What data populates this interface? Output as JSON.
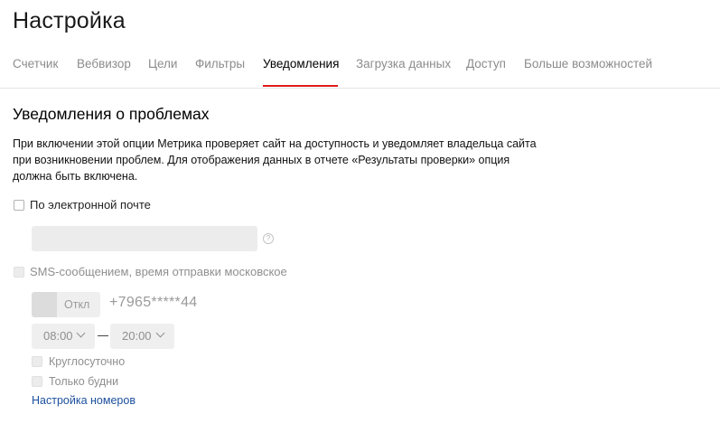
{
  "page": {
    "title": "Настройка"
  },
  "tabs": [
    {
      "label": "Счетчик"
    },
    {
      "label": "Вебвизор"
    },
    {
      "label": "Цели"
    },
    {
      "label": "Фильтры"
    },
    {
      "label": "Уведомления",
      "active": true
    },
    {
      "label": "Загрузка данных"
    },
    {
      "label": "Доступ"
    },
    {
      "label": "Больше возможностей"
    }
  ],
  "section": {
    "title": "Уведомления о проблемах",
    "description": [
      "При включении этой опции Метрика проверяет сайт на доступность и уведомляет владельца сайта",
      "при возникновении проблем. Для отображения данных в отчете «Результаты проверки» опция",
      "должна быть включена."
    ]
  },
  "email": {
    "label": "По электронной почте",
    "checked": false,
    "value": "",
    "help_icon": "?"
  },
  "sms": {
    "label": "SMS-сообщением, время отправки московское",
    "checked": false,
    "disabled": true,
    "toggle_label": "Откл",
    "phone": "+7965*****44",
    "time_from": "08:00",
    "time_to": "20:00",
    "around_clock_label": "Круглосуточно",
    "weekdays_label": "Только будни",
    "numbers_link": "Настройка номеров"
  },
  "colors": {
    "active_tab_underline": "#e01b1b",
    "link": "#1b4f9c"
  }
}
